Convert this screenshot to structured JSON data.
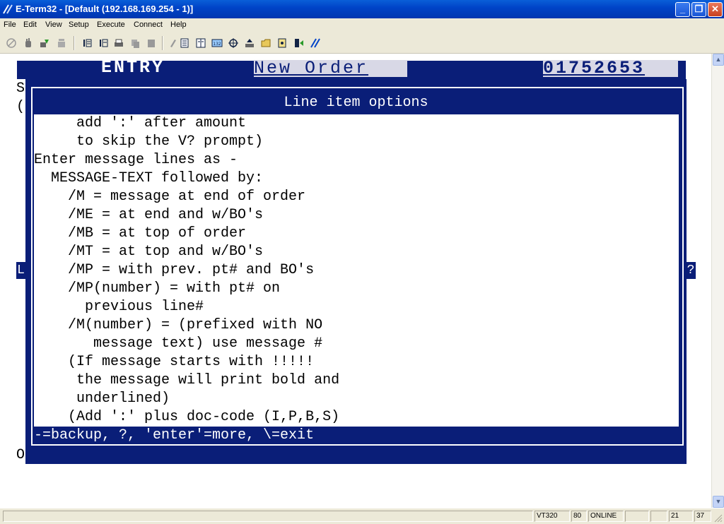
{
  "window": {
    "title": "E-Term32 - [Default (192.168.169.254 - 1)]",
    "controls": {
      "minimize": "_",
      "restore": "❐",
      "close": "✕"
    }
  },
  "menu": [
    "File",
    "Edit",
    "View",
    "Setup",
    "Execute",
    "Connect",
    "Help"
  ],
  "terminal": {
    "header": {
      "entry": "ENTRY",
      "screen": "New Order",
      "order_number": "01752653"
    },
    "background_chars": {
      "s": "S",
      "paren": "(",
      "l": "L",
      "q": "?",
      "o": "O"
    },
    "dialog": {
      "title": "Line item options",
      "lines": [
        "     add ':' after amount",
        "     to skip the V? prompt)",
        "Enter message lines as -",
        "  MESSAGE-TEXT followed by:",
        "    /M = message at end of order",
        "    /ME = at end and w/BO's",
        "    /MB = at top of order",
        "    /MT = at top and w/BO's",
        "    /MP = with prev. pt# and BO's",
        "    /MP(number) = with pt# on",
        "      previous line#",
        "    /M(number) = (prefixed with NO",
        "       message text) use message #",
        "    (If message starts with !!!!!",
        "     the message will print bold and",
        "     underlined)",
        "    (Add ':' plus doc-code (I,P,B,S)"
      ],
      "footer": "-=backup, ?, 'enter'=more, \\=exit "
    },
    "colors": {
      "navy": "#0a1e78",
      "window_blue": "#0044c8"
    }
  },
  "status": {
    "emulation": "VT320",
    "columns": "80",
    "state": "ONLINE",
    "row": "21",
    "col": "37"
  }
}
